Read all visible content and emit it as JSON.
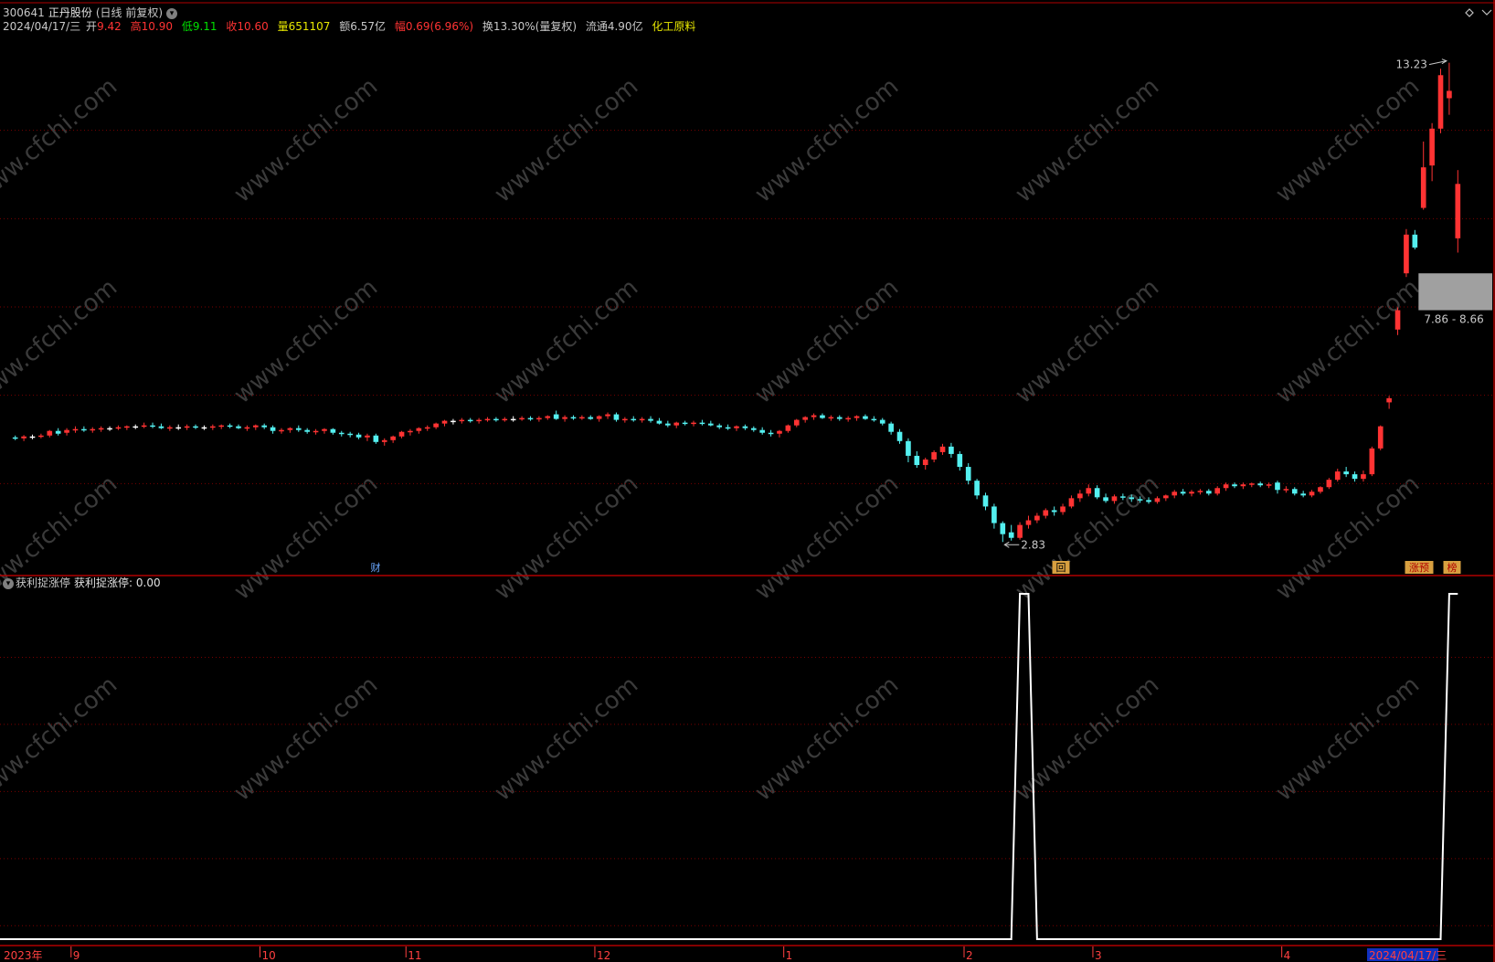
{
  "header": {
    "code": "300641",
    "name": "正丹股份",
    "mode": "(日线 前复权)",
    "date": "2024/04/17/三",
    "open_label": "开",
    "open": "9.42",
    "high_label": "高",
    "high": "10.90",
    "low_label": "低",
    "low": "9.11",
    "close_label": "收",
    "close": "10.60",
    "vol_label": "量",
    "vol": "651107",
    "amount_label": "额",
    "amount": "6.57亿",
    "chg_label": "幅",
    "chg": "0.69(6.96%)",
    "turnover_label": "换",
    "turnover": "13.30%(量复权)",
    "float_label": "流通",
    "float": "4.90亿",
    "sector": "化工原料"
  },
  "indicator": {
    "name": "获利捉涨停",
    "value_label": "获利捉涨停: 0.00"
  },
  "markers": {
    "cai": "财",
    "hui": "回",
    "zhangyu": "涨预",
    "bang": "榜",
    "high_price": "13.23",
    "low_price": "2.83",
    "range": "7.86 - 8.66"
  },
  "watermark": "www.cfchi.com",
  "colors": {
    "up": "#ff3333",
    "down": "#54f0f0",
    "flat": "#ffffff",
    "grid": "#7a0000",
    "gap_box": "#a0a0a0"
  },
  "chart_data": [
    {
      "type": "candlestick",
      "title": "300641 正丹股份 (日线 前复权)",
      "x_ticks": [
        "2023年",
        "9",
        "10",
        "11",
        "12",
        "1",
        "2",
        "3",
        "4",
        "2024/04/17/三"
      ],
      "ylim": [
        2.3,
        13.6
      ],
      "annotations": [
        {
          "label": "13.23",
          "value": 13.23
        },
        {
          "label": "2.83",
          "value": 2.83
        },
        {
          "label": "7.86 - 8.66",
          "range": [
            7.86,
            8.66
          ]
        }
      ],
      "ohlc": [
        [
          5.1,
          5.14,
          5.04,
          5.08
        ],
        [
          5.08,
          5.15,
          5.02,
          5.12
        ],
        [
          5.12,
          5.16,
          5.06,
          5.12
        ],
        [
          5.12,
          5.18,
          5.08,
          5.14
        ],
        [
          5.14,
          5.26,
          5.1,
          5.24
        ],
        [
          5.24,
          5.3,
          5.14,
          5.18
        ],
        [
          5.2,
          5.3,
          5.14,
          5.26
        ],
        [
          5.26,
          5.34,
          5.2,
          5.28
        ],
        [
          5.28,
          5.34,
          5.22,
          5.26
        ],
        [
          5.26,
          5.32,
          5.2,
          5.28
        ],
        [
          5.28,
          5.34,
          5.22,
          5.3
        ],
        [
          5.3,
          5.34,
          5.24,
          5.3
        ],
        [
          5.3,
          5.36,
          5.26,
          5.32
        ],
        [
          5.32,
          5.36,
          5.26,
          5.34
        ],
        [
          5.34,
          5.38,
          5.28,
          5.34
        ],
        [
          5.34,
          5.42,
          5.3,
          5.36
        ],
        [
          5.36,
          5.42,
          5.3,
          5.34
        ],
        [
          5.34,
          5.4,
          5.28,
          5.3
        ],
        [
          5.3,
          5.36,
          5.24,
          5.32
        ],
        [
          5.32,
          5.38,
          5.26,
          5.32
        ],
        [
          5.32,
          5.38,
          5.26,
          5.34
        ],
        [
          5.34,
          5.38,
          5.28,
          5.32
        ],
        [
          5.32,
          5.36,
          5.26,
          5.32
        ],
        [
          5.32,
          5.38,
          5.26,
          5.34
        ],
        [
          5.34,
          5.38,
          5.28,
          5.36
        ],
        [
          5.36,
          5.4,
          5.3,
          5.34
        ],
        [
          5.34,
          5.38,
          5.28,
          5.3
        ],
        [
          5.3,
          5.36,
          5.24,
          5.32
        ],
        [
          5.32,
          5.38,
          5.26,
          5.36
        ],
        [
          5.36,
          5.4,
          5.28,
          5.32
        ],
        [
          5.32,
          5.36,
          5.18,
          5.24
        ],
        [
          5.24,
          5.3,
          5.18,
          5.26
        ],
        [
          5.26,
          5.32,
          5.2,
          5.3
        ],
        [
          5.3,
          5.36,
          5.22,
          5.26
        ],
        [
          5.26,
          5.3,
          5.18,
          5.22
        ],
        [
          5.22,
          5.28,
          5.16,
          5.24
        ],
        [
          5.24,
          5.3,
          5.18,
          5.28
        ],
        [
          5.28,
          5.3,
          5.16,
          5.2
        ],
        [
          5.2,
          5.24,
          5.12,
          5.18
        ],
        [
          5.18,
          5.22,
          5.1,
          5.16
        ],
        [
          5.16,
          5.2,
          5.06,
          5.1
        ],
        [
          5.1,
          5.18,
          5.02,
          5.14
        ],
        [
          5.14,
          5.18,
          4.96,
          5.0
        ],
        [
          5.0,
          5.08,
          4.92,
          5.04
        ],
        [
          5.04,
          5.14,
          4.98,
          5.12
        ],
        [
          5.12,
          5.24,
          5.08,
          5.22
        ],
        [
          5.22,
          5.28,
          5.14,
          5.24
        ],
        [
          5.24,
          5.32,
          5.18,
          5.3
        ],
        [
          5.3,
          5.36,
          5.24,
          5.32
        ],
        [
          5.32,
          5.42,
          5.28,
          5.4
        ],
        [
          5.4,
          5.48,
          5.34,
          5.46
        ],
        [
          5.46,
          5.5,
          5.38,
          5.46
        ],
        [
          5.46,
          5.52,
          5.4,
          5.48
        ],
        [
          5.48,
          5.52,
          5.42,
          5.46
        ],
        [
          5.46,
          5.52,
          5.4,
          5.48
        ],
        [
          5.48,
          5.54,
          5.44,
          5.5
        ],
        [
          5.5,
          5.54,
          5.44,
          5.48
        ],
        [
          5.48,
          5.54,
          5.44,
          5.5
        ],
        [
          5.5,
          5.56,
          5.44,
          5.5
        ],
        [
          5.5,
          5.56,
          5.46,
          5.52
        ],
        [
          5.52,
          5.56,
          5.46,
          5.5
        ],
        [
          5.5,
          5.56,
          5.44,
          5.52
        ],
        [
          5.52,
          5.58,
          5.48,
          5.56
        ],
        [
          5.6,
          5.68,
          5.48,
          5.5
        ],
        [
          5.5,
          5.58,
          5.44,
          5.54
        ],
        [
          5.54,
          5.58,
          5.48,
          5.52
        ],
        [
          5.52,
          5.58,
          5.48,
          5.54
        ],
        [
          5.54,
          5.58,
          5.48,
          5.5
        ],
        [
          5.5,
          5.58,
          5.44,
          5.56
        ],
        [
          5.56,
          5.64,
          5.5,
          5.6
        ],
        [
          5.6,
          5.64,
          5.44,
          5.48
        ],
        [
          5.48,
          5.54,
          5.42,
          5.5
        ],
        [
          5.5,
          5.56,
          5.44,
          5.48
        ],
        [
          5.48,
          5.54,
          5.42,
          5.5
        ],
        [
          5.5,
          5.56,
          5.42,
          5.46
        ],
        [
          5.46,
          5.52,
          5.38,
          5.4
        ],
        [
          5.4,
          5.46,
          5.32,
          5.36
        ],
        [
          5.36,
          5.44,
          5.3,
          5.42
        ],
        [
          5.42,
          5.46,
          5.36,
          5.4
        ],
        [
          5.4,
          5.46,
          5.34,
          5.42
        ],
        [
          5.42,
          5.48,
          5.36,
          5.4
        ],
        [
          5.4,
          5.46,
          5.34,
          5.36
        ],
        [
          5.36,
          5.4,
          5.28,
          5.32
        ],
        [
          5.32,
          5.38,
          5.26,
          5.3
        ],
        [
          5.3,
          5.36,
          5.24,
          5.34
        ],
        [
          5.34,
          5.38,
          5.26,
          5.3
        ],
        [
          5.3,
          5.34,
          5.22,
          5.26
        ],
        [
          5.26,
          5.32,
          5.16,
          5.2
        ],
        [
          5.2,
          5.26,
          5.12,
          5.18
        ],
        [
          5.18,
          5.26,
          5.1,
          5.24
        ],
        [
          5.24,
          5.38,
          5.2,
          5.36
        ],
        [
          5.36,
          5.5,
          5.32,
          5.48
        ],
        [
          5.48,
          5.56,
          5.42,
          5.54
        ],
        [
          5.54,
          5.62,
          5.48,
          5.58
        ],
        [
          5.58,
          5.62,
          5.5,
          5.52
        ],
        [
          5.52,
          5.58,
          5.46,
          5.54
        ],
        [
          5.54,
          5.58,
          5.46,
          5.5
        ],
        [
          5.5,
          5.56,
          5.44,
          5.52
        ],
        [
          5.52,
          5.58,
          5.46,
          5.56
        ],
        [
          5.56,
          5.6,
          5.48,
          5.5
        ],
        [
          5.5,
          5.56,
          5.44,
          5.48
        ],
        [
          5.48,
          5.52,
          5.36,
          5.4
        ],
        [
          5.4,
          5.44,
          5.16,
          5.22
        ],
        [
          5.22,
          5.28,
          4.96,
          5.02
        ],
        [
          5.02,
          5.08,
          4.56,
          4.7
        ],
        [
          4.7,
          4.8,
          4.44,
          4.5
        ],
        [
          4.5,
          4.66,
          4.4,
          4.62
        ],
        [
          4.62,
          4.82,
          4.56,
          4.78
        ],
        [
          4.78,
          4.96,
          4.72,
          4.9
        ],
        [
          4.9,
          4.98,
          4.66,
          4.74
        ],
        [
          4.74,
          4.8,
          4.38,
          4.46
        ],
        [
          4.46,
          4.54,
          4.08,
          4.16
        ],
        [
          4.16,
          4.2,
          3.76,
          3.84
        ],
        [
          3.84,
          3.9,
          3.52,
          3.6
        ],
        [
          3.6,
          3.66,
          3.12,
          3.24
        ],
        [
          3.24,
          3.28,
          2.83,
          3.0
        ],
        [
          3.04,
          3.2,
          2.86,
          2.92
        ],
        [
          2.92,
          3.26,
          2.88,
          3.2
        ],
        [
          3.2,
          3.4,
          3.12,
          3.3
        ],
        [
          3.3,
          3.46,
          3.24,
          3.4
        ],
        [
          3.4,
          3.56,
          3.34,
          3.52
        ],
        [
          3.52,
          3.6,
          3.4,
          3.48
        ],
        [
          3.48,
          3.66,
          3.42,
          3.6
        ],
        [
          3.6,
          3.84,
          3.56,
          3.78
        ],
        [
          3.78,
          3.96,
          3.7,
          3.88
        ],
        [
          3.88,
          4.08,
          3.82,
          4.0
        ],
        [
          4.0,
          4.06,
          3.76,
          3.8
        ],
        [
          3.8,
          3.88,
          3.68,
          3.72
        ],
        [
          3.72,
          3.86,
          3.66,
          3.82
        ],
        [
          3.82,
          3.88,
          3.74,
          3.8
        ],
        [
          3.8,
          3.86,
          3.7,
          3.76
        ],
        [
          3.76,
          3.82,
          3.68,
          3.74
        ],
        [
          3.74,
          3.8,
          3.66,
          3.7
        ],
        [
          3.7,
          3.82,
          3.66,
          3.78
        ],
        [
          3.78,
          3.86,
          3.72,
          3.84
        ],
        [
          3.84,
          3.96,
          3.78,
          3.92
        ],
        [
          3.92,
          3.98,
          3.84,
          3.88
        ],
        [
          3.88,
          3.96,
          3.82,
          3.92
        ],
        [
          3.92,
          3.98,
          3.86,
          3.94
        ],
        [
          3.94,
          3.98,
          3.84,
          3.88
        ],
        [
          3.88,
          4.04,
          3.84,
          4.0
        ],
        [
          4.0,
          4.12,
          3.94,
          4.08
        ],
        [
          4.08,
          4.12,
          4.0,
          4.04
        ],
        [
          4.04,
          4.12,
          3.98,
          4.08
        ],
        [
          4.08,
          4.12,
          4.02,
          4.1
        ],
        [
          4.1,
          4.14,
          4.02,
          4.06
        ],
        [
          4.06,
          4.12,
          4.0,
          4.08
        ],
        [
          4.12,
          4.16,
          3.88,
          3.96
        ],
        [
          3.96,
          4.04,
          3.9,
          3.98
        ],
        [
          3.98,
          4.02,
          3.84,
          3.88
        ],
        [
          3.88,
          3.94,
          3.8,
          3.84
        ],
        [
          3.84,
          3.96,
          3.8,
          3.92
        ],
        [
          3.92,
          4.04,
          3.88,
          4.02
        ],
        [
          4.02,
          4.22,
          3.98,
          4.18
        ],
        [
          4.18,
          4.42,
          4.14,
          4.36
        ],
        [
          4.36,
          4.46,
          4.24,
          4.3
        ],
        [
          4.3,
          4.36,
          4.14,
          4.2
        ],
        [
          4.2,
          4.38,
          4.14,
          4.3
        ],
        [
          4.3,
          4.9,
          4.26,
          4.86
        ],
        [
          4.86,
          5.36,
          4.82,
          5.34
        ],
        [
          5.86,
          6.0,
          5.72,
          5.95
        ],
        [
          7.44,
          7.92,
          7.32,
          7.86
        ],
        [
          8.66,
          9.62,
          8.58,
          9.5
        ],
        [
          9.5,
          9.6,
          9.18,
          9.22
        ],
        [
          10.08,
          11.52,
          10.04,
          10.96
        ],
        [
          11.0,
          11.92,
          10.66,
          11.8
        ],
        [
          11.8,
          13.1,
          11.7,
          12.96
        ],
        [
          12.46,
          13.23,
          12.1,
          12.62
        ],
        [
          9.42,
          10.9,
          9.11,
          10.6
        ]
      ],
      "type_note": "candlestick"
    },
    {
      "type": "line",
      "title": "获利捉涨停",
      "series": [
        {
          "name": "获利捉涨停",
          "values": "binary step series, 1 at days 117-118, 167-171, 174"
        }
      ],
      "ylim": [
        0,
        1
      ]
    }
  ]
}
